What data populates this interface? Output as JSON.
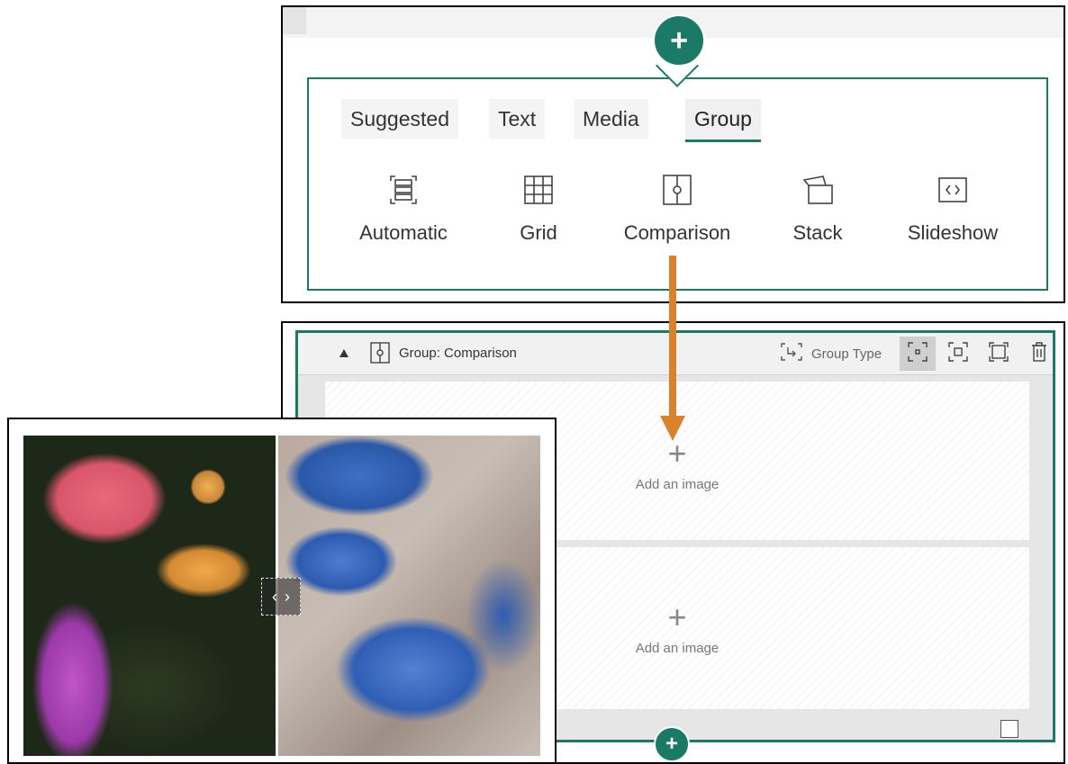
{
  "menu": {
    "tabs": [
      {
        "label": "Suggested"
      },
      {
        "label": "Text"
      },
      {
        "label": "Media"
      },
      {
        "label": "Group",
        "selected": true
      }
    ],
    "options": [
      {
        "label": "Automatic",
        "icon": "automatic-layout-icon"
      },
      {
        "label": "Grid",
        "icon": "grid-icon"
      },
      {
        "label": "Comparison",
        "icon": "comparison-icon"
      },
      {
        "label": "Stack",
        "icon": "stack-icon"
      },
      {
        "label": "Slideshow",
        "icon": "slideshow-icon"
      }
    ]
  },
  "group_card": {
    "title": "Group: Comparison",
    "group_type_label": "Group Type",
    "drop_zones": [
      {
        "text": "Add an image"
      },
      {
        "text": "Add an image"
      }
    ]
  },
  "colors": {
    "accent": "#1a7a66",
    "arrow": "#d9822b"
  }
}
